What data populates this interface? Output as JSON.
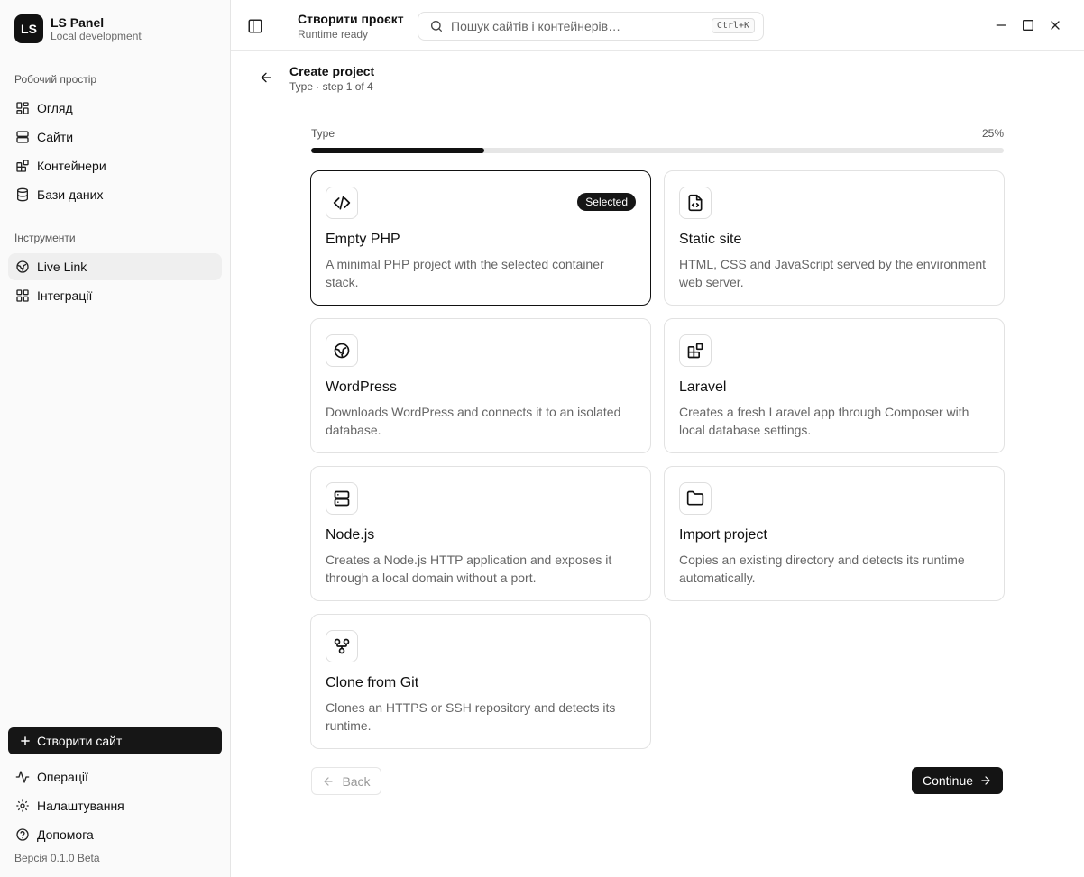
{
  "brand": {
    "logo": "LS",
    "title": "LS Panel",
    "subtitle": "Local development"
  },
  "sidebar": {
    "workspace_label": "Робочий простір",
    "workspace_items": [
      {
        "label": "Огляд",
        "icon": "layout-grid-icon"
      },
      {
        "label": "Сайти",
        "icon": "server-icon"
      },
      {
        "label": "Контейнери",
        "icon": "blocks-icon"
      },
      {
        "label": "Бази даних",
        "icon": "database-icon"
      }
    ],
    "tools_label": "Інструменти",
    "tools_items": [
      {
        "label": "Live Link",
        "icon": "globe-icon",
        "active": true
      },
      {
        "label": "Інтеграції",
        "icon": "grid-icon"
      }
    ],
    "create_site_label": "Створити сайт",
    "bottom_items": [
      {
        "label": "Операції",
        "icon": "activity-icon"
      },
      {
        "label": "Налаштування",
        "icon": "gear-icon"
      },
      {
        "label": "Допомога",
        "icon": "help-circle-icon"
      }
    ],
    "version": "Версія 0.1.0 Beta"
  },
  "topbar": {
    "title": "Створити проєкт",
    "subtitle": "Runtime ready",
    "search_placeholder": "Пошук сайтів і контейнерів…",
    "search_shortcut": "Ctrl+K"
  },
  "page": {
    "title": "Create project",
    "subtitle": "Type · step 1 of 4",
    "step_label": "Type",
    "progress_label": "25%",
    "progress_value": 0.25
  },
  "cards": [
    {
      "title": "Empty PHP",
      "description": "A minimal PHP project with the selected container stack.",
      "icon": "code-icon",
      "selected": true,
      "badge": "Selected"
    },
    {
      "title": "Static site",
      "description": "HTML, CSS and JavaScript served by the environment web server.",
      "icon": "file-code-icon"
    },
    {
      "title": "WordPress",
      "description": "Downloads WordPress and connects it to an isolated database.",
      "icon": "globe-icon"
    },
    {
      "title": "Laravel",
      "description": "Creates a fresh Laravel app through Composer with local database settings.",
      "icon": "blocks-icon"
    },
    {
      "title": "Node.js",
      "description": "Creates a Node.js HTTP application and exposes it through a local domain without a port.",
      "icon": "server-icon"
    },
    {
      "title": "Import project",
      "description": "Copies an existing directory and detects its runtime automatically.",
      "icon": "folder-icon"
    },
    {
      "title": "Clone from Git",
      "description": "Clones an HTTPS or SSH repository and detects its runtime.",
      "icon": "git-fork-icon"
    }
  ],
  "footer": {
    "back_label": "Back",
    "continue_label": "Continue"
  },
  "colors": {
    "accent": "#111111",
    "sidebar_bg": "#fafafa",
    "border": "#e2e2e2",
    "muted_text": "#666666"
  }
}
